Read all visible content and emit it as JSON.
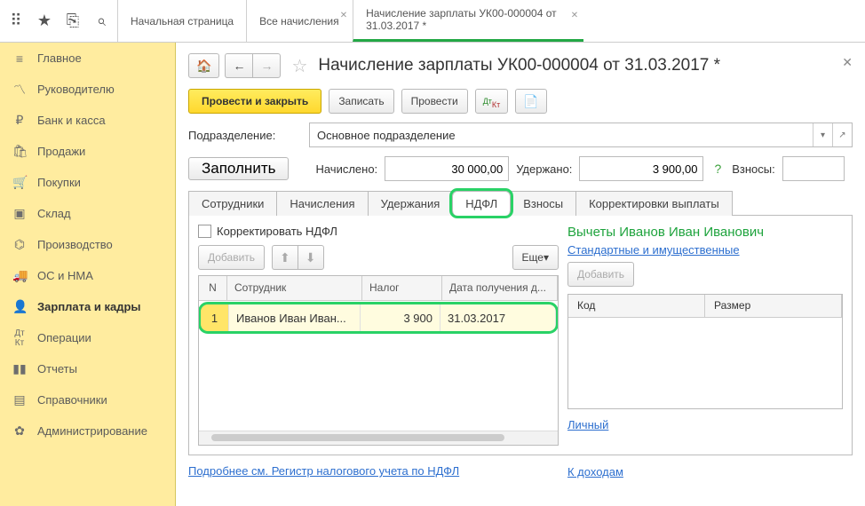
{
  "topIcons": [
    "apps",
    "star",
    "clip",
    "search"
  ],
  "headTabs": [
    {
      "label": "Начальная страница",
      "closable": false
    },
    {
      "label": "Все начисления",
      "closable": true
    },
    {
      "label": "Начисление зарплаты УК00-000004 от 31.03.2017 *",
      "closable": true,
      "active": true
    }
  ],
  "sidebar": [
    {
      "icon": "≡",
      "label": "Главное"
    },
    {
      "icon": "📈",
      "label": "Руководителю"
    },
    {
      "icon": "₽",
      "label": "Банк и касса"
    },
    {
      "icon": "🛍",
      "label": "Продажи"
    },
    {
      "icon": "🛒",
      "label": "Покупки"
    },
    {
      "icon": "📦",
      "label": "Склад"
    },
    {
      "icon": "🏭",
      "label": "Производство"
    },
    {
      "icon": "🚚",
      "label": "ОС и НМА"
    },
    {
      "icon": "👤",
      "label": "Зарплата и кадры",
      "bold": true
    },
    {
      "icon": "ᴬₖ",
      "label": "Операции"
    },
    {
      "icon": "📊",
      "label": "Отчеты"
    },
    {
      "icon": "📘",
      "label": "Справочники"
    },
    {
      "icon": "⚙",
      "label": "Администрирование"
    }
  ],
  "pageTitle": "Начисление зарплаты УК00-000004 от 31.03.2017 *",
  "actions": {
    "postClose": "Провести и закрыть",
    "write": "Записать",
    "post": "Провести"
  },
  "fields": {
    "departmentLabel": "Подразделение:",
    "departmentValue": "Основное подразделение",
    "fillBtn": "Заполнить",
    "accruedLabel": "Начислено:",
    "accruedValue": "30 000,00",
    "withheldLabel": "Удержано:",
    "withheldValue": "3 900,00",
    "contribLabel": "Взносы:",
    "contribValue": ""
  },
  "tabs": [
    "Сотрудники",
    "Начисления",
    "Удержания",
    "НДФЛ",
    "Взносы",
    "Корректировки выплаты"
  ],
  "activeTab": 3,
  "ndfl": {
    "correctChk": "Корректировать НДФЛ",
    "addBtn": "Добавить",
    "moreBtn": "Еще",
    "columns": {
      "n": "N",
      "employee": "Сотрудник",
      "tax": "Налог",
      "date": "Дата получения д..."
    },
    "rows": [
      {
        "n": "1",
        "employee": "Иванов Иван Иван...",
        "tax": "3 900",
        "date": "31.03.2017"
      }
    ]
  },
  "right": {
    "title": "Вычеты Иванов Иван Иванович",
    "stdLink": "Стандартные и имущественные",
    "addBtn": "Добавить",
    "cols": {
      "code": "Код",
      "size": "Размер"
    },
    "personal": "Личный",
    "toIncome": "К доходам"
  },
  "bottomLink": "Подробнее см. Регистр налогового учета по НДФЛ"
}
